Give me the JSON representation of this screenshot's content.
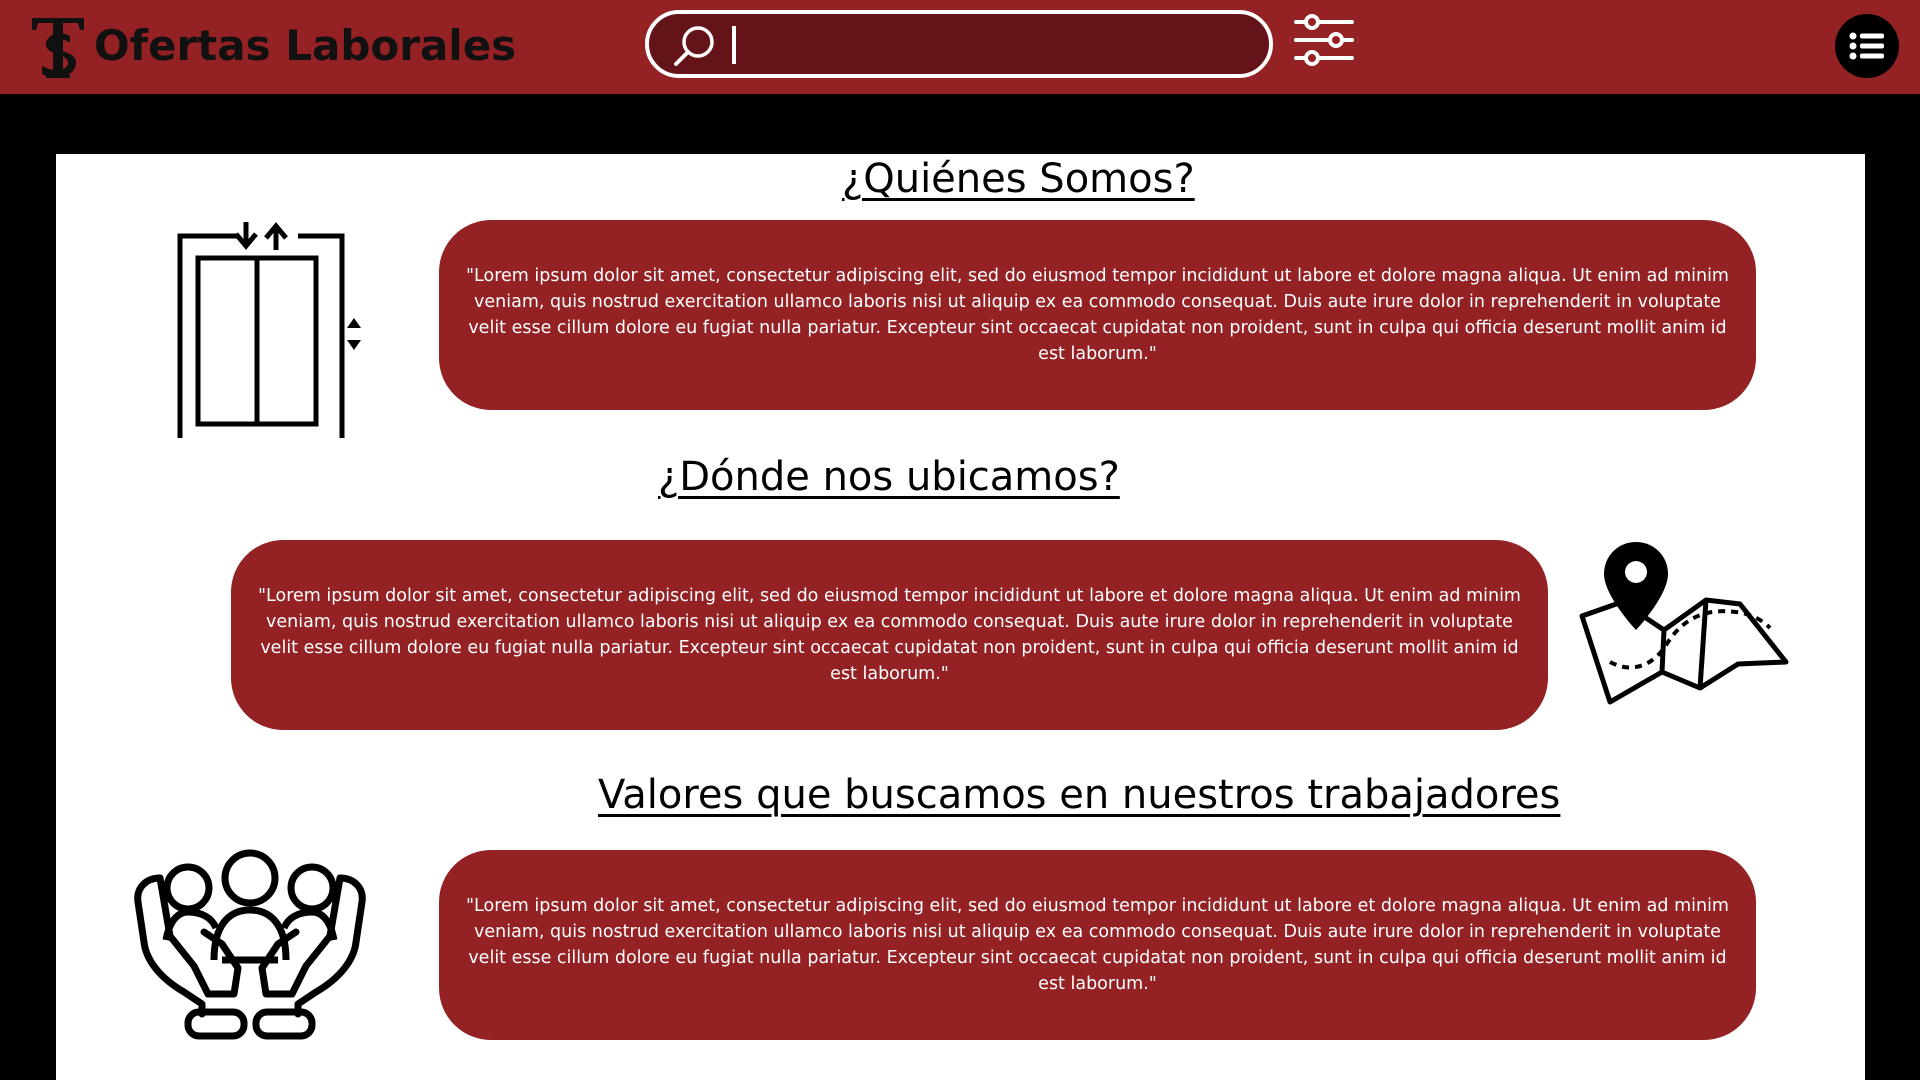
{
  "colors": {
    "brand": "#942124",
    "search_fill": "#641418",
    "page_bg": "#000000",
    "content_bg": "#ffffff"
  },
  "header": {
    "logo_icon": "ts-monogram-logo",
    "title": "Ofertas Laborales",
    "search": {
      "icon": "search-icon",
      "value": "",
      "placeholder": ""
    },
    "filter_icon": "sliders-icon",
    "menu_icon": "list-menu-icon"
  },
  "sections": [
    {
      "heading": "¿Quiénes Somos?",
      "text": "\"Lorem ipsum dolor sit amet, consectetur adipiscing elit, sed do eiusmod tempor incididunt ut labore et dolore magna aliqua. Ut enim ad minim veniam, quis nostrud exercitation ullamco laboris nisi ut aliquip ex ea commodo consequat. Duis aute irure dolor in reprehenderit in voluptate velit esse cillum dolore eu fugiat nulla pariatur. Excepteur sint occaecat cupidatat non proident, sunt in culpa qui officia deserunt mollit anim id est laborum.\"",
      "icon": "elevator-icon"
    },
    {
      "heading": "¿Dónde nos ubicamos?",
      "text": "\"Lorem ipsum dolor sit amet, consectetur adipiscing elit, sed do eiusmod tempor incididunt ut labore et dolore magna aliqua. Ut enim ad minim veniam, quis nostrud exercitation ullamco laboris nisi ut aliquip ex ea commodo consequat. Duis aute irure dolor in reprehenderit in voluptate velit esse cillum dolore eu fugiat nulla pariatur. Excepteur sint occaecat cupidatat non proident, sunt in culpa qui officia deserunt mollit anim id est laborum.\"",
      "icon": "map-location-icon"
    },
    {
      "heading": "Valores que buscamos en nuestros trabajadores",
      "text": "\"Lorem ipsum dolor sit amet, consectetur adipiscing elit, sed do eiusmod tempor incididunt ut labore et dolore magna aliqua. Ut enim ad minim veniam, quis nostrud exercitation ullamco laboris nisi ut aliquip ex ea commodo consequat. Duis aute irure dolor in reprehenderit in voluptate velit esse cillum dolore eu fugiat nulla pariatur. Excepteur sint occaecat cupidatat non proident, sunt in culpa qui officia deserunt mollit anim id est laborum.\"",
      "icon": "team-hands-icon"
    }
  ]
}
